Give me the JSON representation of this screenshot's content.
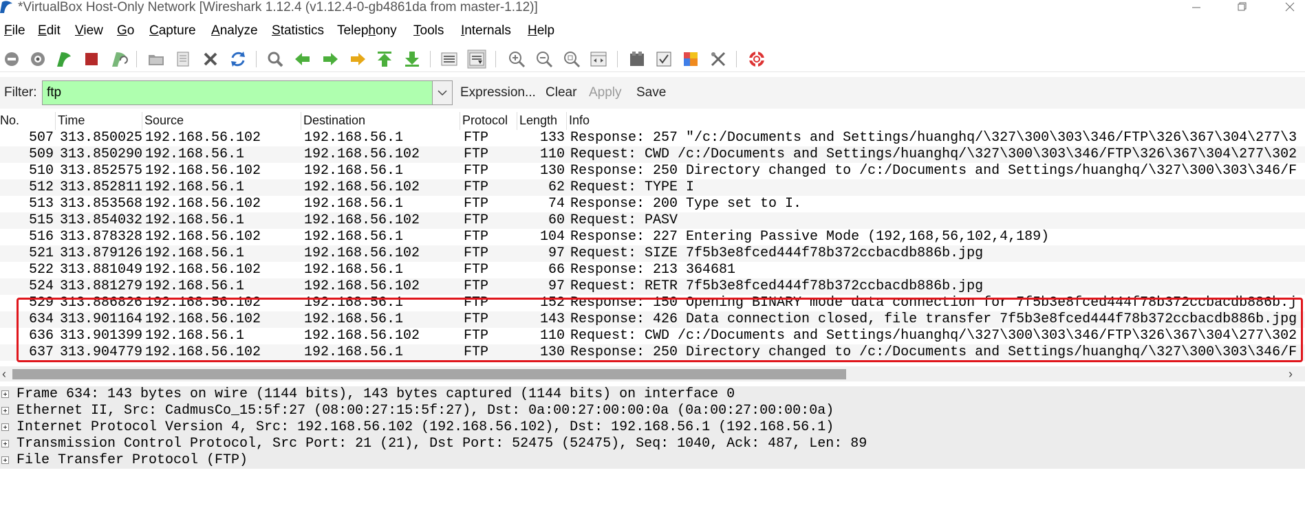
{
  "window": {
    "title": "*VirtualBox Host-Only Network   [Wireshark 1.12.4  (v1.12.4-0-gb4861da from master-1.12)]"
  },
  "menu": [
    {
      "ul": "F",
      "rest": "ile"
    },
    {
      "ul": "E",
      "rest": "dit"
    },
    {
      "ul": "V",
      "rest": "iew"
    },
    {
      "ul": "G",
      "rest": "o"
    },
    {
      "ul": "C",
      "rest": "apture"
    },
    {
      "ul": "A",
      "rest": "nalyze"
    },
    {
      "ul": "S",
      "rest": "tatistics"
    },
    {
      "pre": "Telep",
      "ul": "h",
      "rest": "ony"
    },
    {
      "ul": "T",
      "rest": "ools"
    },
    {
      "ul": "I",
      "rest": "nternals"
    },
    {
      "ul": "H",
      "rest": "elp"
    }
  ],
  "toolbar_icons": [
    "interface-list-icon",
    "capture-options-icon",
    "start-capture-icon",
    "stop-capture-icon",
    "restart-capture-icon",
    "open-file-icon",
    "save-file-icon",
    "close-file-icon",
    "reload-icon",
    "find-packet-icon",
    "go-back-icon",
    "go-forward-icon",
    "go-to-packet-icon",
    "go-first-icon",
    "go-last-icon",
    "colorize-icon",
    "auto-scroll-icon",
    "zoom-in-icon",
    "zoom-out-icon",
    "zoom-normal-icon",
    "resize-columns-icon",
    "capture-filters-icon",
    "display-filters-icon",
    "coloring-rules-icon",
    "preferences-icon",
    "help-icon"
  ],
  "filter": {
    "label": "Filter:",
    "value": "ftp",
    "expression": "Expression...",
    "clear": "Clear",
    "apply": "Apply",
    "save": "Save",
    "input_color": "#afffaf"
  },
  "columns": [
    "No.",
    "Time",
    "Source",
    "Destination",
    "Protocol",
    "Length",
    "Info"
  ],
  "packets": [
    {
      "no": "507",
      "time": "313.850025",
      "src": "192.168.56.102",
      "dst": "192.168.56.1",
      "proto": "FTP",
      "len": "133",
      "info": "Response: 257 \"/c:/Documents and Settings/huanghq/\\327\\300\\303\\346/FTP\\326\\367\\304\\277\\3"
    },
    {
      "no": "509",
      "time": "313.850290",
      "src": "192.168.56.1",
      "dst": "192.168.56.102",
      "proto": "FTP",
      "len": "110",
      "info": "Request: CWD /c:/Documents and Settings/huanghq/\\327\\300\\303\\346/FTP\\326\\367\\304\\277\\302"
    },
    {
      "no": "510",
      "time": "313.852575",
      "src": "192.168.56.102",
      "dst": "192.168.56.1",
      "proto": "FTP",
      "len": "130",
      "info": "Response: 250 Directory changed to /c:/Documents and Settings/huanghq/\\327\\300\\303\\346/F"
    },
    {
      "no": "512",
      "time": "313.852811",
      "src": "192.168.56.1",
      "dst": "192.168.56.102",
      "proto": "FTP",
      "len": "62",
      "info": "Request: TYPE I"
    },
    {
      "no": "513",
      "time": "313.853568",
      "src": "192.168.56.102",
      "dst": "192.168.56.1",
      "proto": "FTP",
      "len": "74",
      "info": "Response: 200 Type set to I."
    },
    {
      "no": "515",
      "time": "313.854032",
      "src": "192.168.56.1",
      "dst": "192.168.56.102",
      "proto": "FTP",
      "len": "60",
      "info": "Request: PASV"
    },
    {
      "no": "516",
      "time": "313.878328",
      "src": "192.168.56.102",
      "dst": "192.168.56.1",
      "proto": "FTP",
      "len": "104",
      "info": "Response: 227 Entering Passive Mode (192,168,56,102,4,189)"
    },
    {
      "no": "521",
      "time": "313.879126",
      "src": "192.168.56.1",
      "dst": "192.168.56.102",
      "proto": "FTP",
      "len": "97",
      "info": "Request: SIZE 7f5b3e8fced444f78b372ccbacdb886b.jpg"
    },
    {
      "no": "522",
      "time": "313.881049",
      "src": "192.168.56.102",
      "dst": "192.168.56.1",
      "proto": "FTP",
      "len": "66",
      "info": "Response: 213 364681"
    },
    {
      "no": "524",
      "time": "313.881279",
      "src": "192.168.56.1",
      "dst": "192.168.56.102",
      "proto": "FTP",
      "len": "97",
      "info": "Request: RETR 7f5b3e8fced444f78b372ccbacdb886b.jpg"
    },
    {
      "no": "529",
      "time": "313.886826",
      "src": "192.168.56.102",
      "dst": "192.168.56.1",
      "proto": "FTP",
      "len": "152",
      "info": "Response: 150 Opening BINARY mode data connection for 7f5b3e8fced444f78b372ccbacdb886b.j"
    },
    {
      "no": "634",
      "time": "313.901164",
      "src": "192.168.56.102",
      "dst": "192.168.56.1",
      "proto": "FTP",
      "len": "143",
      "info": "Response: 426 Data connection closed, file transfer 7f5b3e8fced444f78b372ccbacdb886b.jpg"
    },
    {
      "no": "636",
      "time": "313.901399",
      "src": "192.168.56.1",
      "dst": "192.168.56.102",
      "proto": "FTP",
      "len": "110",
      "info": "Request: CWD /c:/Documents and Settings/huanghq/\\327\\300\\303\\346/FTP\\326\\367\\304\\277\\302"
    },
    {
      "no": "637",
      "time": "313.904779",
      "src": "192.168.56.102",
      "dst": "192.168.56.1",
      "proto": "FTP",
      "len": "130",
      "info": "Response: 250 Directory changed to /c:/Documents and Settings/huanghq/\\327\\300\\303\\346/F"
    }
  ],
  "details": [
    "Frame 634: 143 bytes on wire (1144 bits), 143 bytes captured (1144 bits) on interface 0",
    "Ethernet II, Src: CadmusCo_15:5f:27 (08:00:27:15:5f:27), Dst: 0a:00:27:00:00:0a (0a:00:27:00:00:0a)",
    "Internet Protocol Version 4, Src: 192.168.56.102 (192.168.56.102), Dst: 192.168.56.1 (192.168.56.1)",
    "Transmission Control Protocol, Src Port: 21 (21), Dst Port: 52475 (52475), Seq: 1040, Ack: 487, Len: 89",
    "File Transfer Protocol (FTP)"
  ],
  "highlight_color": "#e0161c"
}
